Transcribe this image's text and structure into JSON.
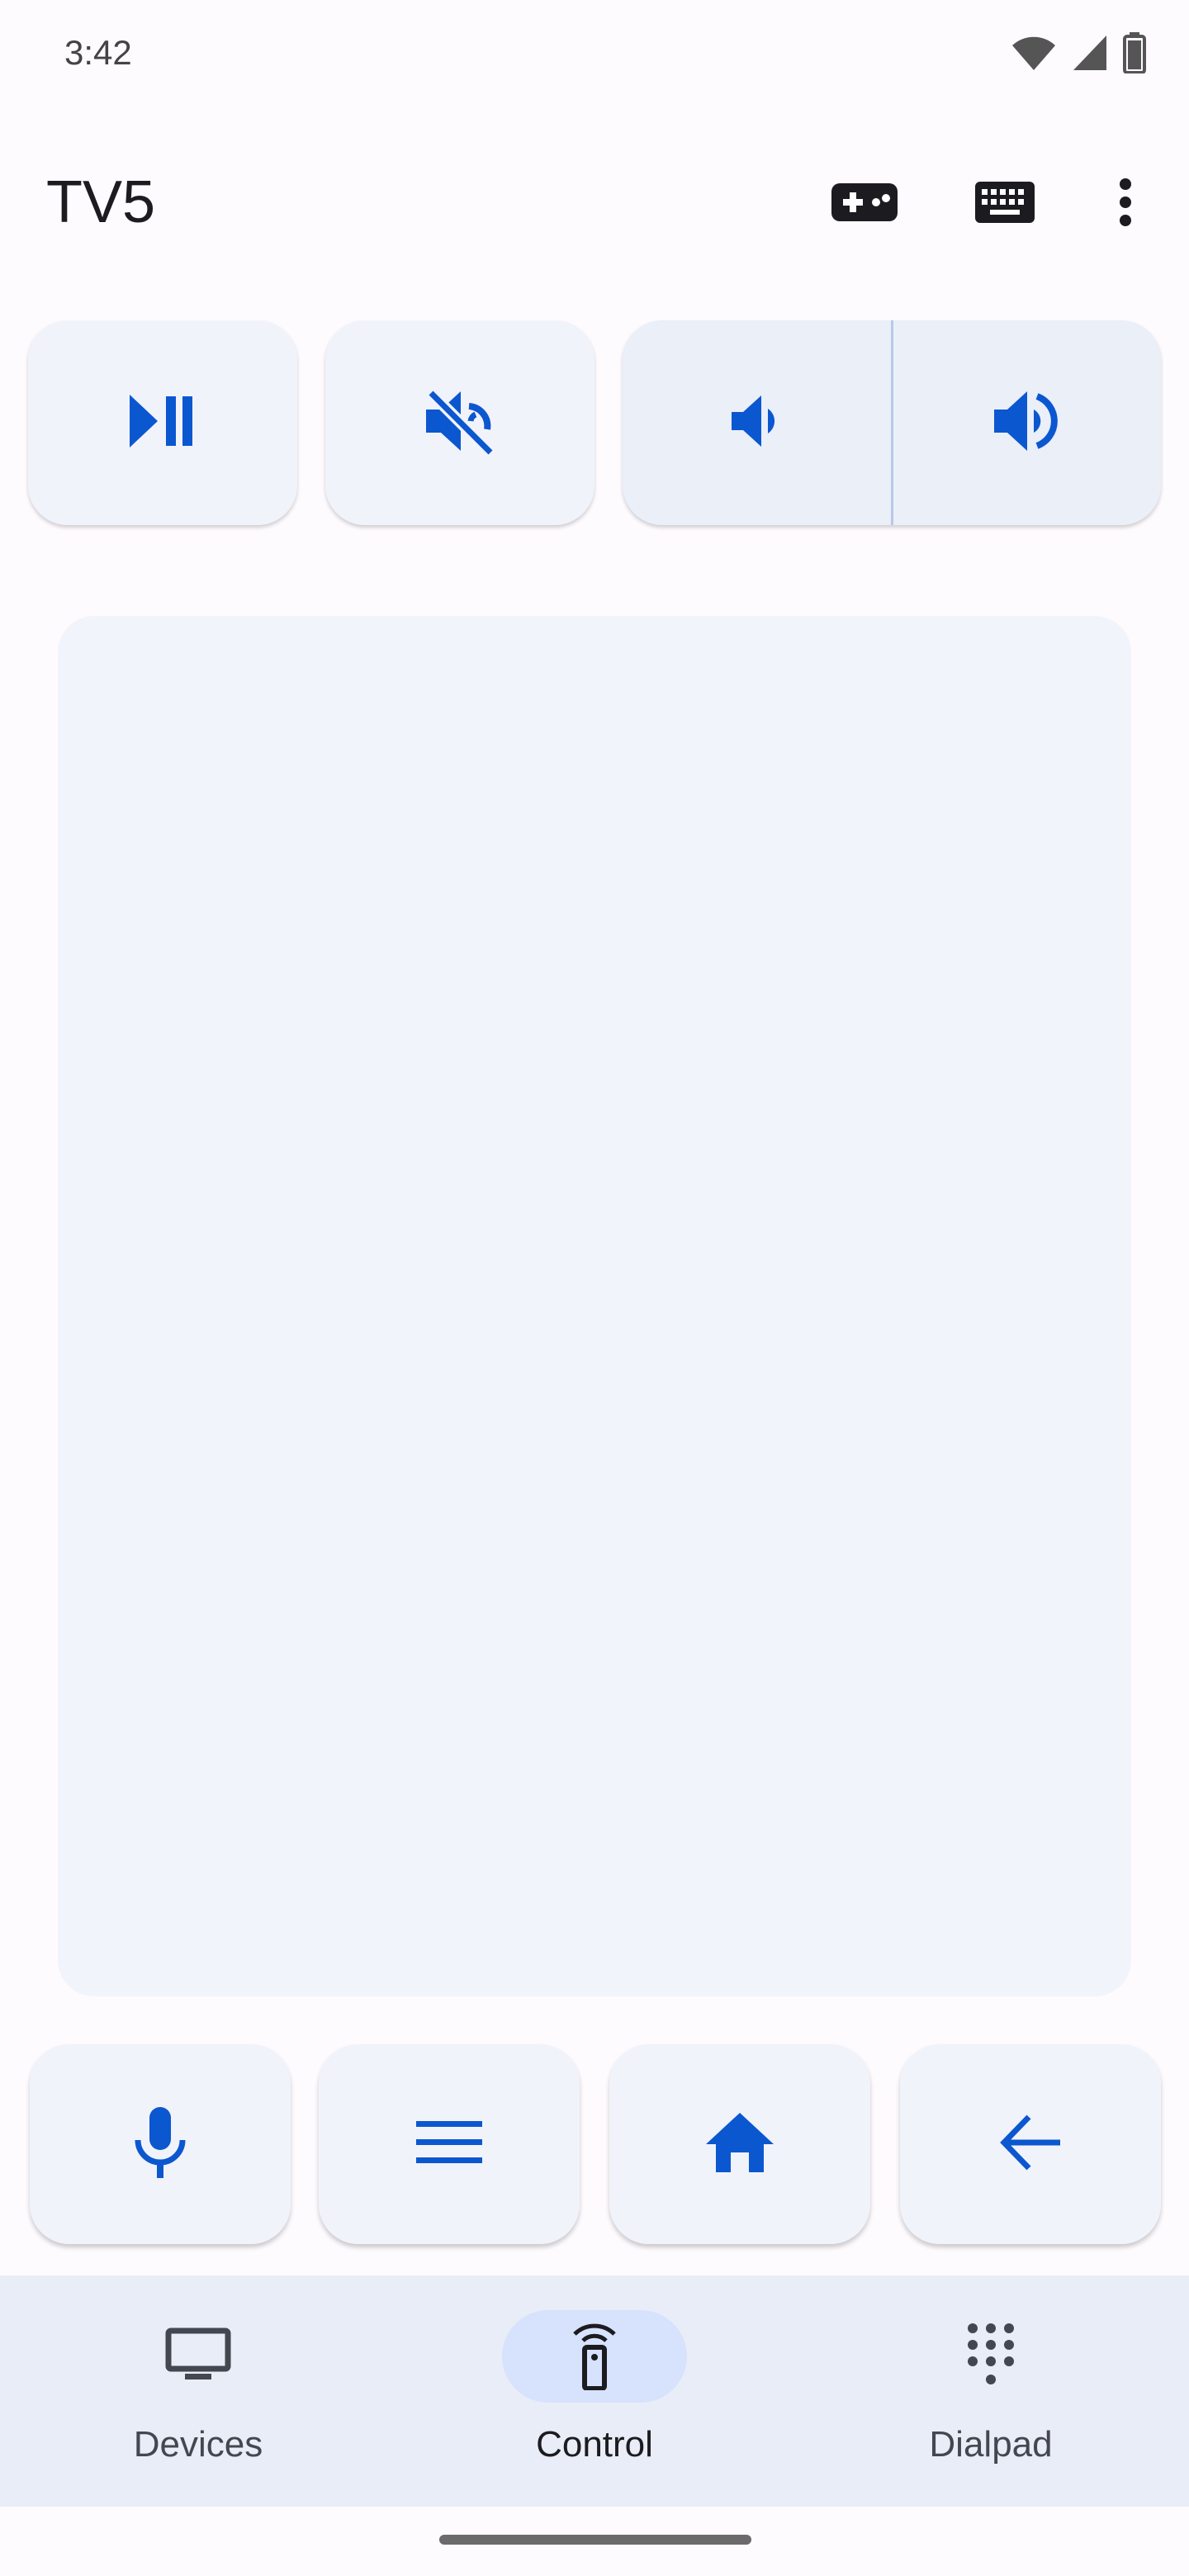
{
  "status_bar": {
    "time": "3:42",
    "icons": [
      "wifi-icon",
      "signal-icon",
      "battery-icon"
    ]
  },
  "app_bar": {
    "title": "TV5",
    "actions": [
      "gamepad-icon",
      "keyboard-icon",
      "more-vert-icon"
    ]
  },
  "media_controls": {
    "buttons": [
      "play-pause-icon",
      "mute-icon",
      "volume-down-icon",
      "volume-up-icon"
    ]
  },
  "remote_buttons": [
    "mic-icon",
    "menu-icon",
    "home-icon",
    "back-arrow-icon"
  ],
  "bottom_nav": {
    "items": [
      {
        "label": "Devices",
        "icon": "tv-icon",
        "active": false
      },
      {
        "label": "Control",
        "icon": "remote-icon",
        "active": true
      },
      {
        "label": "Dialpad",
        "icon": "dialpad-icon",
        "active": false
      }
    ]
  },
  "colors": {
    "accent": "#0b57d0",
    "button_bg": "#f1f3fa",
    "nav_bg": "#e9edf7",
    "active_pill": "#d7e2fc"
  }
}
